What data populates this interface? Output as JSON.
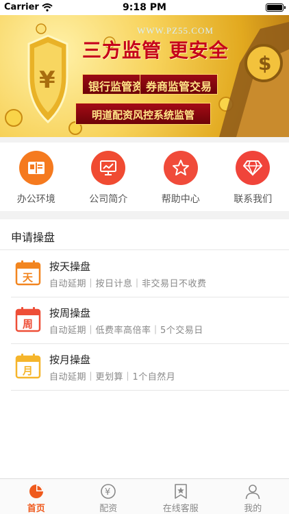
{
  "status_bar": {
    "carrier": "Carrier",
    "time": "9:18 PM"
  },
  "banner": {
    "watermark": "WWW.PZ55.COM",
    "headline": "三方监管 更安全",
    "tags": [
      "银行监管资金",
      "券商监管交易"
    ],
    "footer": "明道配资风控系统监管"
  },
  "quick_nav": [
    {
      "label": "办公环境",
      "icon": "book-icon",
      "color": "#f57a1f"
    },
    {
      "label": "公司简介",
      "icon": "presentation-chart-icon",
      "color": "#f04b32"
    },
    {
      "label": "帮助中心",
      "icon": "star-icon",
      "color": "#f04b3a"
    },
    {
      "label": "联系我们",
      "icon": "diamond-icon",
      "color": "#f0443a"
    }
  ],
  "section": {
    "title": "申请操盘"
  },
  "plans": [
    {
      "icon_char": "天",
      "title": "按天操盘",
      "desc": "自动延期｜按日计息｜非交易日不收费",
      "color": "#f2851f"
    },
    {
      "icon_char": "周",
      "title": "按周操盘",
      "desc": "自动延期｜低费率高倍率｜5个交易日",
      "color": "#ee4e37"
    },
    {
      "icon_char": "月",
      "title": "按月操盘",
      "desc": "自动延期｜更划算｜1个自然月",
      "color": "#f5b52b"
    }
  ],
  "tab_bar": [
    {
      "label": "首页",
      "icon": "pie-chart-icon",
      "active": true
    },
    {
      "label": "配资",
      "icon": "yen-coin-icon",
      "active": false
    },
    {
      "label": "在线客服",
      "icon": "bookmark-star-icon",
      "active": false
    },
    {
      "label": "我的",
      "icon": "user-icon",
      "active": false
    }
  ],
  "colors": {
    "accent": "#ef5a1d",
    "inactive": "#888888",
    "divider": "#e6e6e6"
  }
}
